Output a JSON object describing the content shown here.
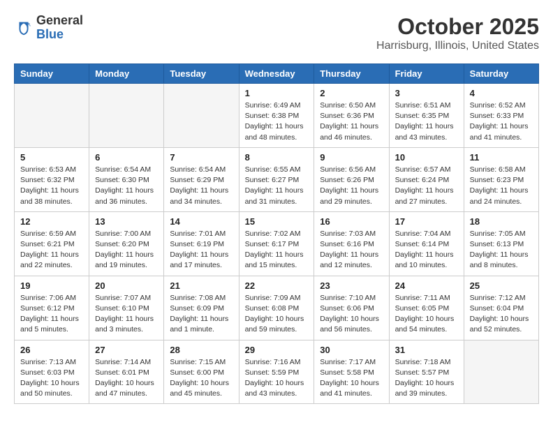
{
  "header": {
    "logo_line1": "General",
    "logo_line2": "Blue",
    "title": "October 2025",
    "subtitle": "Harrisburg, Illinois, United States"
  },
  "weekdays": [
    "Sunday",
    "Monday",
    "Tuesday",
    "Wednesday",
    "Thursday",
    "Friday",
    "Saturday"
  ],
  "weeks": [
    [
      {
        "day": "",
        "empty": true
      },
      {
        "day": "",
        "empty": true
      },
      {
        "day": "",
        "empty": true
      },
      {
        "day": "1",
        "sunrise": "6:49 AM",
        "sunset": "6:38 PM",
        "daylight": "11 hours and 48 minutes."
      },
      {
        "day": "2",
        "sunrise": "6:50 AM",
        "sunset": "6:36 PM",
        "daylight": "11 hours and 46 minutes."
      },
      {
        "day": "3",
        "sunrise": "6:51 AM",
        "sunset": "6:35 PM",
        "daylight": "11 hours and 43 minutes."
      },
      {
        "day": "4",
        "sunrise": "6:52 AM",
        "sunset": "6:33 PM",
        "daylight": "11 hours and 41 minutes."
      }
    ],
    [
      {
        "day": "5",
        "sunrise": "6:53 AM",
        "sunset": "6:32 PM",
        "daylight": "11 hours and 38 minutes."
      },
      {
        "day": "6",
        "sunrise": "6:54 AM",
        "sunset": "6:30 PM",
        "daylight": "11 hours and 36 minutes."
      },
      {
        "day": "7",
        "sunrise": "6:54 AM",
        "sunset": "6:29 PM",
        "daylight": "11 hours and 34 minutes."
      },
      {
        "day": "8",
        "sunrise": "6:55 AM",
        "sunset": "6:27 PM",
        "daylight": "11 hours and 31 minutes."
      },
      {
        "day": "9",
        "sunrise": "6:56 AM",
        "sunset": "6:26 PM",
        "daylight": "11 hours and 29 minutes."
      },
      {
        "day": "10",
        "sunrise": "6:57 AM",
        "sunset": "6:24 PM",
        "daylight": "11 hours and 27 minutes."
      },
      {
        "day": "11",
        "sunrise": "6:58 AM",
        "sunset": "6:23 PM",
        "daylight": "11 hours and 24 minutes."
      }
    ],
    [
      {
        "day": "12",
        "sunrise": "6:59 AM",
        "sunset": "6:21 PM",
        "daylight": "11 hours and 22 minutes."
      },
      {
        "day": "13",
        "sunrise": "7:00 AM",
        "sunset": "6:20 PM",
        "daylight": "11 hours and 19 minutes."
      },
      {
        "day": "14",
        "sunrise": "7:01 AM",
        "sunset": "6:19 PM",
        "daylight": "11 hours and 17 minutes."
      },
      {
        "day": "15",
        "sunrise": "7:02 AM",
        "sunset": "6:17 PM",
        "daylight": "11 hours and 15 minutes."
      },
      {
        "day": "16",
        "sunrise": "7:03 AM",
        "sunset": "6:16 PM",
        "daylight": "11 hours and 12 minutes."
      },
      {
        "day": "17",
        "sunrise": "7:04 AM",
        "sunset": "6:14 PM",
        "daylight": "11 hours and 10 minutes."
      },
      {
        "day": "18",
        "sunrise": "7:05 AM",
        "sunset": "6:13 PM",
        "daylight": "11 hours and 8 minutes."
      }
    ],
    [
      {
        "day": "19",
        "sunrise": "7:06 AM",
        "sunset": "6:12 PM",
        "daylight": "11 hours and 5 minutes."
      },
      {
        "day": "20",
        "sunrise": "7:07 AM",
        "sunset": "6:10 PM",
        "daylight": "11 hours and 3 minutes."
      },
      {
        "day": "21",
        "sunrise": "7:08 AM",
        "sunset": "6:09 PM",
        "daylight": "11 hours and 1 minute."
      },
      {
        "day": "22",
        "sunrise": "7:09 AM",
        "sunset": "6:08 PM",
        "daylight": "10 hours and 59 minutes."
      },
      {
        "day": "23",
        "sunrise": "7:10 AM",
        "sunset": "6:06 PM",
        "daylight": "10 hours and 56 minutes."
      },
      {
        "day": "24",
        "sunrise": "7:11 AM",
        "sunset": "6:05 PM",
        "daylight": "10 hours and 54 minutes."
      },
      {
        "day": "25",
        "sunrise": "7:12 AM",
        "sunset": "6:04 PM",
        "daylight": "10 hours and 52 minutes."
      }
    ],
    [
      {
        "day": "26",
        "sunrise": "7:13 AM",
        "sunset": "6:03 PM",
        "daylight": "10 hours and 50 minutes."
      },
      {
        "day": "27",
        "sunrise": "7:14 AM",
        "sunset": "6:01 PM",
        "daylight": "10 hours and 47 minutes."
      },
      {
        "day": "28",
        "sunrise": "7:15 AM",
        "sunset": "6:00 PM",
        "daylight": "10 hours and 45 minutes."
      },
      {
        "day": "29",
        "sunrise": "7:16 AM",
        "sunset": "5:59 PM",
        "daylight": "10 hours and 43 minutes."
      },
      {
        "day": "30",
        "sunrise": "7:17 AM",
        "sunset": "5:58 PM",
        "daylight": "10 hours and 41 minutes."
      },
      {
        "day": "31",
        "sunrise": "7:18 AM",
        "sunset": "5:57 PM",
        "daylight": "10 hours and 39 minutes."
      },
      {
        "day": "",
        "empty": true
      }
    ]
  ]
}
